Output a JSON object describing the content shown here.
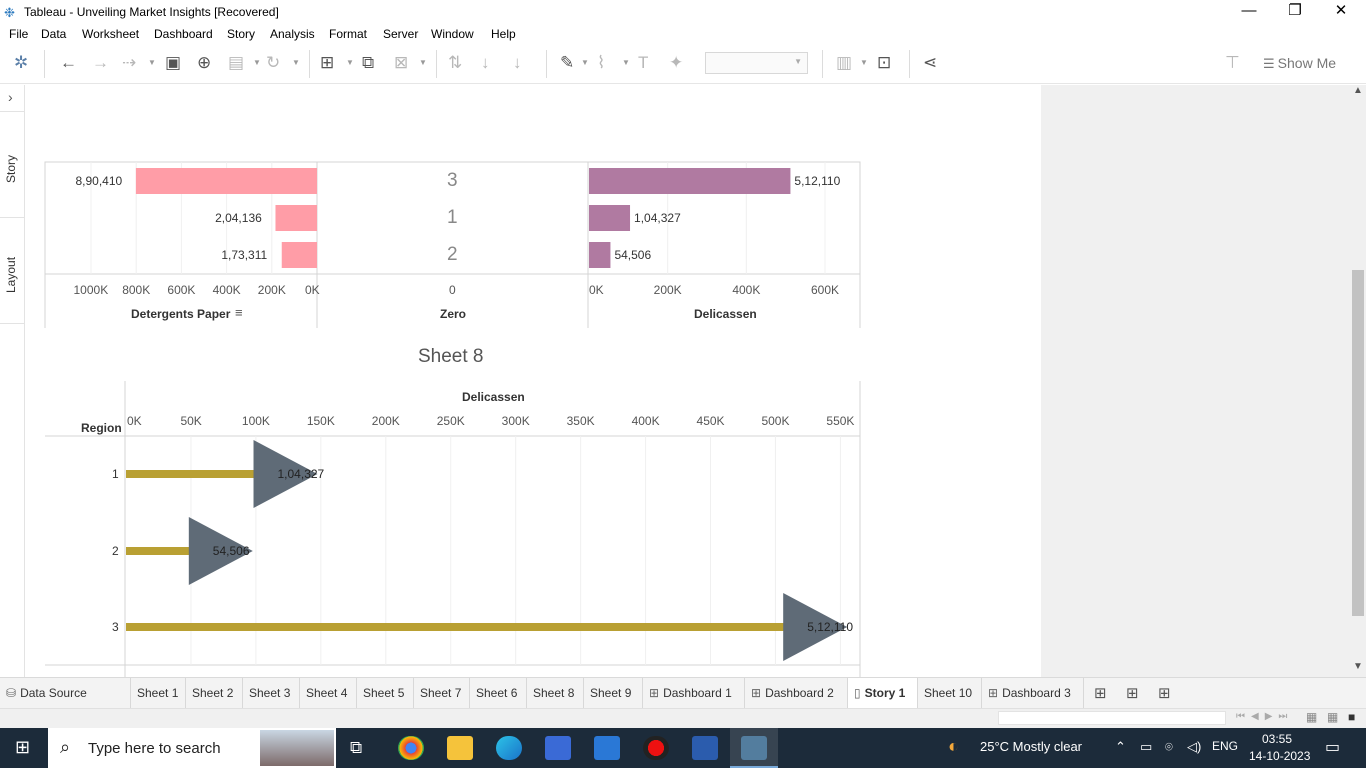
{
  "window": {
    "title": "Tableau - Unveiling Market Insights [Recovered]",
    "minimize": "—",
    "maximize": "❐",
    "close": "✕"
  },
  "menu": [
    "File",
    "Data",
    "Worksheet",
    "Dashboard",
    "Story",
    "Analysis",
    "Format",
    "Server",
    "Window",
    "Help"
  ],
  "toolbar": {
    "show_me": "Show Me",
    "fit_value": ""
  },
  "left_rail": {
    "expand": "›",
    "story": "Story",
    "layout": "Layout"
  },
  "colors": {
    "detergents_bar": "#ff9da7",
    "delicassen_bar": "#b07aa1",
    "lollipop_bar": "#b9a033",
    "lollipop_marker": "#5f6b77",
    "taskbar": "#1c2b3a"
  },
  "top_chart": {
    "left": {
      "field": "Detergents Paper",
      "values": [
        "8,90,410",
        "2,04,136",
        "1,73,311"
      ],
      "data": [
        890410,
        204136,
        173311
      ],
      "ticks": [
        "1000K",
        "800K",
        "600K",
        "400K",
        "200K",
        "0K"
      ],
      "sort_icon": "sort-descending-icon"
    },
    "middle": {
      "field": "Zero",
      "regions": [
        "3",
        "1",
        "2"
      ],
      "tick": "0"
    },
    "right": {
      "field": "Delicassen",
      "values": [
        "5,12,110",
        "1,04,327",
        "54,506"
      ],
      "data": [
        512110,
        104327,
        54506
      ],
      "ticks": [
        "0K",
        "200K",
        "400K",
        "600K"
      ]
    }
  },
  "bottom_chart": {
    "title": "Sheet 8",
    "x_field": "Delicassen",
    "row_header": "Region",
    "ticks": [
      "0K",
      "50K",
      "100K",
      "150K",
      "200K",
      "250K",
      "300K",
      "350K",
      "400K",
      "450K",
      "500K",
      "550K"
    ],
    "rows": [
      {
        "region": "1",
        "value": 104327,
        "label": "1,04,327"
      },
      {
        "region": "2",
        "value": 54506,
        "label": "54,506"
      },
      {
        "region": "3",
        "value": 512110,
        "label": "5,12,110"
      }
    ]
  },
  "chart_data": [
    {
      "type": "bar",
      "title": "",
      "categories": [
        "3",
        "1",
        "2"
      ],
      "series": [
        {
          "name": "Detergents Paper",
          "values": [
            890410,
            204136,
            173311
          ]
        },
        {
          "name": "Delicassen",
          "values": [
            512110,
            104327,
            54506
          ]
        }
      ],
      "xlabel_left": "Detergents Paper",
      "xlabel_center": "Zero",
      "xlabel_right": "Delicassen"
    },
    {
      "type": "bar",
      "title": "Sheet 8",
      "categories": [
        "1",
        "2",
        "3"
      ],
      "values": [
        104327,
        54506,
        512110
      ],
      "xlabel": "Delicassen",
      "ylabel": "Region",
      "xlim": [
        0,
        550000
      ]
    }
  ],
  "tabs": [
    {
      "label": "Data Source",
      "icon": "database-icon"
    },
    {
      "label": "Sheet 1"
    },
    {
      "label": "Sheet 2"
    },
    {
      "label": "Sheet 3"
    },
    {
      "label": "Sheet 4"
    },
    {
      "label": "Sheet 5"
    },
    {
      "label": "Sheet 7"
    },
    {
      "label": "Sheet 6"
    },
    {
      "label": "Sheet 8"
    },
    {
      "label": "Sheet 9"
    },
    {
      "label": "Dashboard 1",
      "icon": "dashboard-icon"
    },
    {
      "label": "Dashboard 2",
      "icon": "dashboard-icon"
    },
    {
      "label": "Story 1",
      "icon": "story-icon",
      "active": true
    },
    {
      "label": "Sheet 10"
    },
    {
      "label": "Dashboard 3",
      "icon": "dashboard-icon"
    }
  ],
  "taskbar": {
    "search_placeholder": "Type here to search",
    "weather": "25°C  Mostly clear",
    "lang": "ENG",
    "time": "03:55",
    "date": "14-10-2023"
  }
}
